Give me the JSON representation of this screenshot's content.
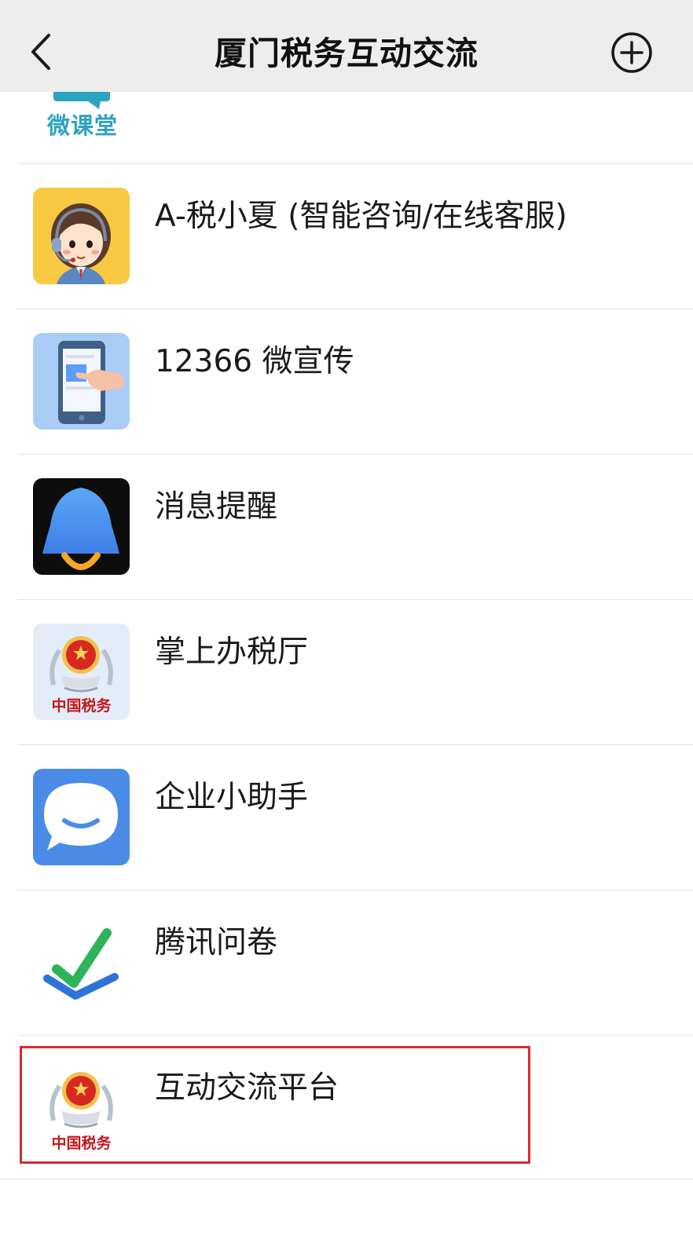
{
  "header": {
    "title": "厦门税务互动交流",
    "back_icon": "chevron-left-icon",
    "add_icon": "plus-circle-icon"
  },
  "first_item": {
    "icon_text": "微课堂"
  },
  "items": [
    {
      "label": "A-税小夏 (智能咨询/在线客服)",
      "icon": "customer-service-avatar-icon"
    },
    {
      "label": "12366 微宣传",
      "icon": "tablet-touch-icon"
    },
    {
      "label": "消息提醒",
      "icon": "bell-icon"
    },
    {
      "label": "掌上办税厅",
      "icon": "tax-emblem-icon",
      "emblem_text": "中国税务"
    },
    {
      "label": "企业小助手",
      "icon": "chat-bubble-icon"
    },
    {
      "label": "腾讯问卷",
      "icon": "checkmark-icon"
    },
    {
      "label": "互动交流平台",
      "icon": "tax-emblem-icon",
      "emblem_text": "中国税务"
    }
  ],
  "colors": {
    "navbar_bg": "#ededed",
    "highlight_border": "#d62b33",
    "weiketang_text": "#2ca3bf",
    "bell_blue": "#5b9ef6",
    "chat_blue": "#4a8be8",
    "check_green": "#2db35a",
    "check_blue": "#2e73d9"
  }
}
